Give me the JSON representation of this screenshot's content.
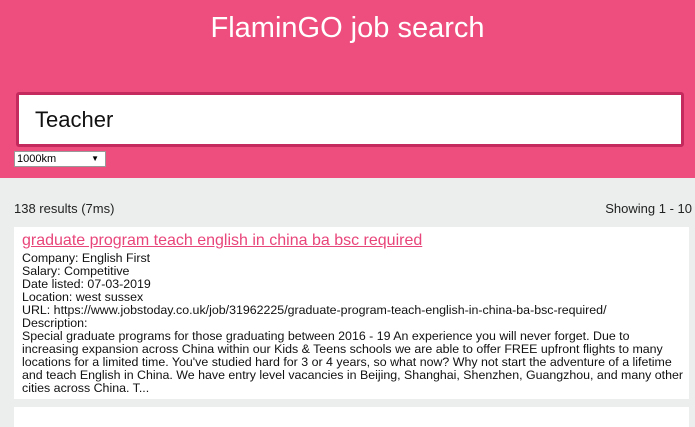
{
  "header": {
    "title": "FlaminGO job search"
  },
  "search": {
    "value": "Teacher"
  },
  "distance": {
    "selected": "1000km"
  },
  "results": {
    "count_text": "138 results (7ms)",
    "showing_text": "Showing 1 - 10"
  },
  "items": [
    {
      "title": "graduate program teach english in china ba bsc required",
      "company": "Company: English First",
      "salary": "Salary: Competitive",
      "date": "Date listed: 07-03-2019",
      "location": "Location: west sussex",
      "url": "URL: https://www.jobstoday.co.uk/job/31962225/graduate-program-teach-english-in-china-ba-bsc-required/",
      "description_label": "Description:",
      "description": "Special graduate programs for those graduating between 2016 - 19 An experience you will never forget. Due to increasing expansion across China within our Kids & Teens schools we are able to offer FREE upfront flights to many locations for a limited time. You've studied hard for 3 or 4 years, so what now? Why not start the adventure of a lifetime and teach English in China. We have entry level vacancies in Beijing, Shanghai, Shenzhen, Guangzhou, and many other cities across China. T..."
    }
  ],
  "colors": {
    "brand": "#ee4e7e",
    "border": "#c42a5d",
    "link": "#e8457a",
    "background": "#eceeee"
  }
}
